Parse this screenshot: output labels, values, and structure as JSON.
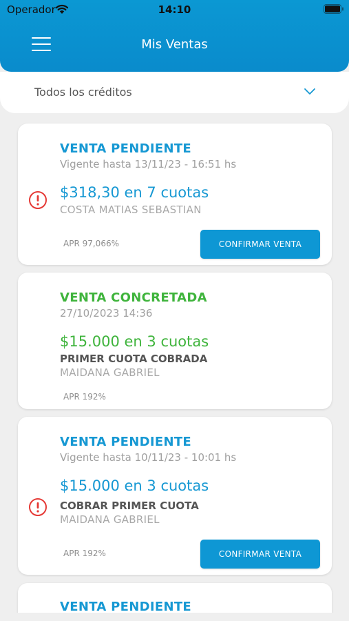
{
  "status_bar": {
    "carrier": "Operador",
    "time": "14:10"
  },
  "header": {
    "title": "Mis Ventas"
  },
  "filter": {
    "label": "Todos los créditos"
  },
  "colors": {
    "brand": "#0b98d3",
    "pending": "#1698d3",
    "done": "#3fb43c",
    "alert": "#e53935"
  },
  "cards": [
    {
      "title": "VENTA PENDIENTE",
      "subtitle": "Vigente hasta 13/11/23 - 16:51 hs",
      "amount": "$318,30 en 7 cuotas",
      "client": "COSTA MATIAS SEBASTIAN",
      "apr": "APR 97,066%",
      "button": "CONFIRMAR VENTA"
    },
    {
      "title": "VENTA CONCRETADA",
      "subtitle": "27/10/2023 14:36",
      "amount": "$15.000 en 3 cuotas",
      "status": "PRIMER CUOTA COBRADA",
      "client": "MAIDANA GABRIEL",
      "apr": "APR 192%"
    },
    {
      "title": "VENTA PENDIENTE",
      "subtitle": "Vigente hasta 10/11/23 - 10:01 hs",
      "amount": "$15.000 en 3 cuotas",
      "status": "COBRAR PRIMER CUOTA",
      "client": "MAIDANA GABRIEL",
      "apr": "APR 192%",
      "button": "CONFIRMAR VENTA"
    },
    {
      "title": "VENTA PENDIENTE"
    }
  ]
}
